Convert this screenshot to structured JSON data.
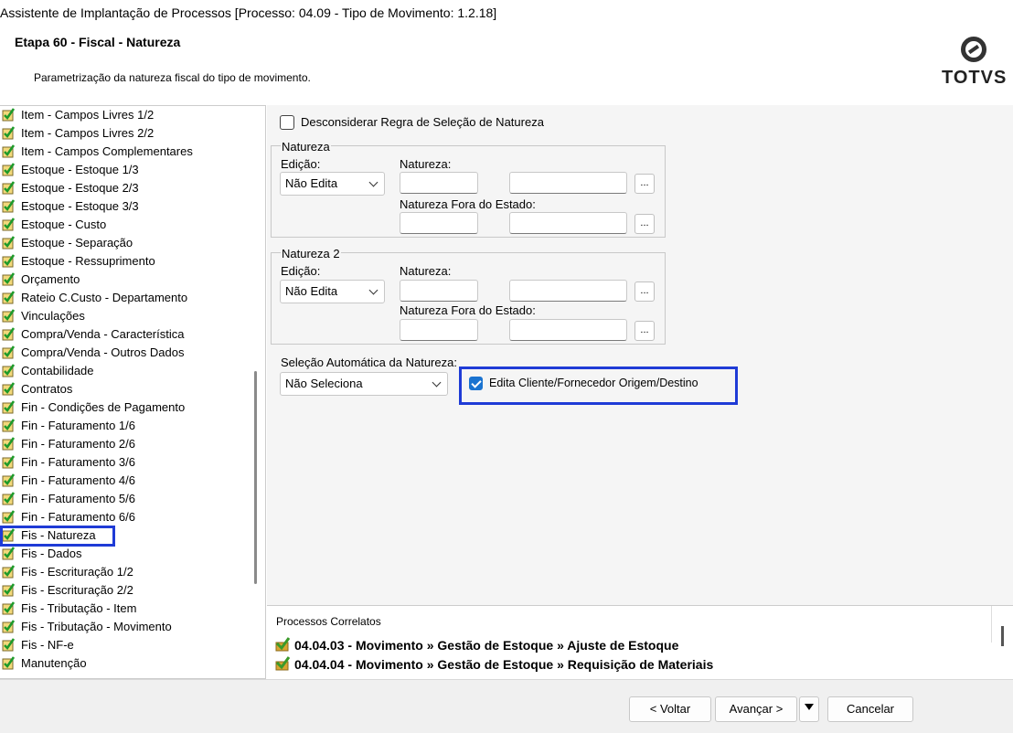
{
  "window": {
    "title": "Assistente de Implantação de Processos [Processo: 04.09 - Tipo de Movimento: 1.2.18]"
  },
  "header": {
    "step": "Etapa 60 - Fiscal - Natureza",
    "description": "Parametrização da natureza fiscal do tipo de movimento.",
    "logo_text": "TOTVS"
  },
  "tree": {
    "items": [
      "Item - Campos Livres 1/2",
      "Item - Campos Livres 2/2",
      "Item - Campos Complementares",
      "Estoque - Estoque 1/3",
      "Estoque - Estoque 2/3",
      "Estoque - Estoque 3/3",
      "Estoque - Custo",
      "Estoque - Separação",
      "Estoque - Ressuprimento",
      "Orçamento",
      "Rateio C.Custo - Departamento",
      "Vinculações",
      "Compra/Venda - Característica",
      "Compra/Venda - Outros Dados",
      "Contabilidade",
      "Contratos",
      "Fin - Condições de Pagamento",
      "Fin - Faturamento 1/6",
      "Fin - Faturamento 2/6",
      "Fin - Faturamento 3/6",
      "Fin - Faturamento 4/6",
      "Fin - Faturamento 5/6",
      "Fin - Faturamento 6/6",
      "Fis - Natureza",
      "Fis - Dados",
      "Fis - Escrituração 1/2",
      "Fis - Escrituração 2/2",
      "Fis - Tributação - Item",
      "Fis - Tributação - Movimento",
      "Fis - NF-e",
      "Manutenção"
    ],
    "selected": "Fis - Natureza"
  },
  "form": {
    "ignore_rule_label": "Desconsiderar Regra de Seleção de Natureza",
    "ignore_rule_checked": false,
    "group1": {
      "title": "Natureza",
      "edit_label": "Edição:",
      "edit_value": "Não Edita",
      "natureza_label": "Natureza:",
      "fora_label": "Natureza Fora do Estado:",
      "browse": "..."
    },
    "group2": {
      "title": "Natureza 2",
      "edit_label": "Edição:",
      "edit_value": "Não Edita",
      "natureza_label": "Natureza:",
      "fora_label": "Natureza Fora do Estado:",
      "browse": "..."
    },
    "auto_select_label": "Seleção Automática da Natureza:",
    "auto_select_value": "Não Seleciona",
    "edit_client_label": "Edita Cliente/Fornecedor Origem/Destino",
    "edit_client_checked": true
  },
  "related": {
    "title": "Processos Correlatos",
    "rows": [
      "04.04.03 - Movimento » Gestão de Estoque » Ajuste de Estoque",
      "04.04.04 - Movimento » Gestão de Estoque » Requisição de Materiais"
    ]
  },
  "footer": {
    "back": "< Voltar",
    "next": "Avançar >",
    "cancel": "Cancelar"
  },
  "colors": {
    "highlight": "#1f3bd6",
    "check_accent": "#1a73d0"
  }
}
